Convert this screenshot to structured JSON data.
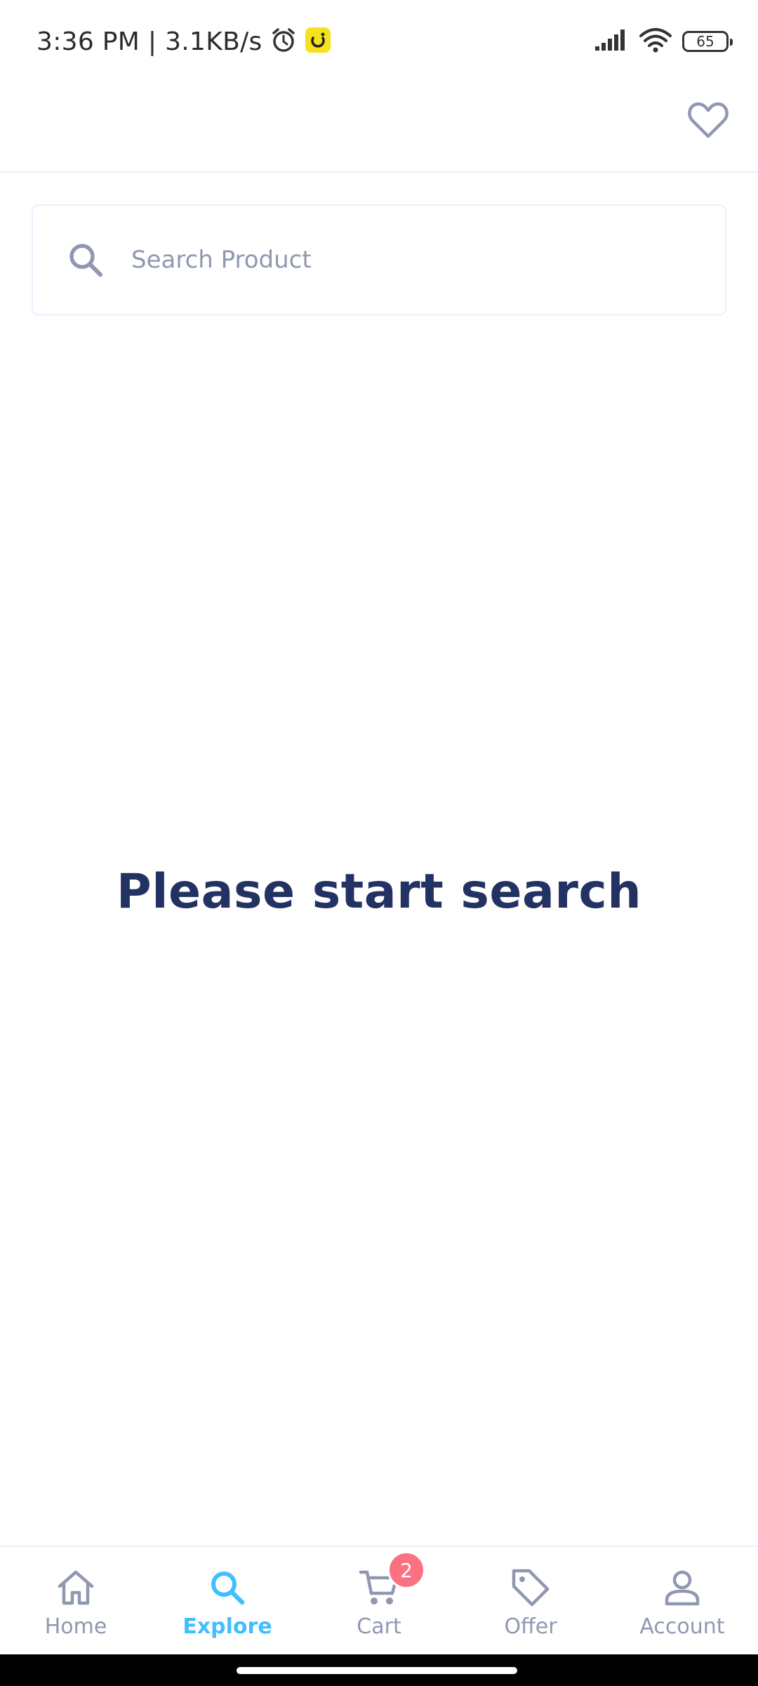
{
  "status_bar": {
    "time_text": "3:36 PM | 3.1KB/s",
    "battery_level": "65",
    "icons": [
      "alarm-icon",
      "app-notification-icon",
      "signal-icon",
      "wifi-icon",
      "battery-icon"
    ]
  },
  "header": {
    "favorite_icon": "heart-icon"
  },
  "search": {
    "placeholder": "Search Product",
    "value": "",
    "icon": "search-icon"
  },
  "empty_state": {
    "message": "Please start search"
  },
  "bottom_nav": {
    "items": [
      {
        "label": "Home",
        "icon": "home-icon",
        "active": false
      },
      {
        "label": "Explore",
        "icon": "search-icon",
        "active": true
      },
      {
        "label": "Cart",
        "icon": "cart-icon",
        "active": false,
        "badge": "2"
      },
      {
        "label": "Offer",
        "icon": "tag-icon",
        "active": false
      },
      {
        "label": "Account",
        "icon": "user-icon",
        "active": false
      }
    ]
  },
  "colors": {
    "primary": "#40BFFF",
    "text_dark": "#223263",
    "text_muted": "#9098B1",
    "border": "#EBF0FF",
    "badge": "#FB7181"
  }
}
